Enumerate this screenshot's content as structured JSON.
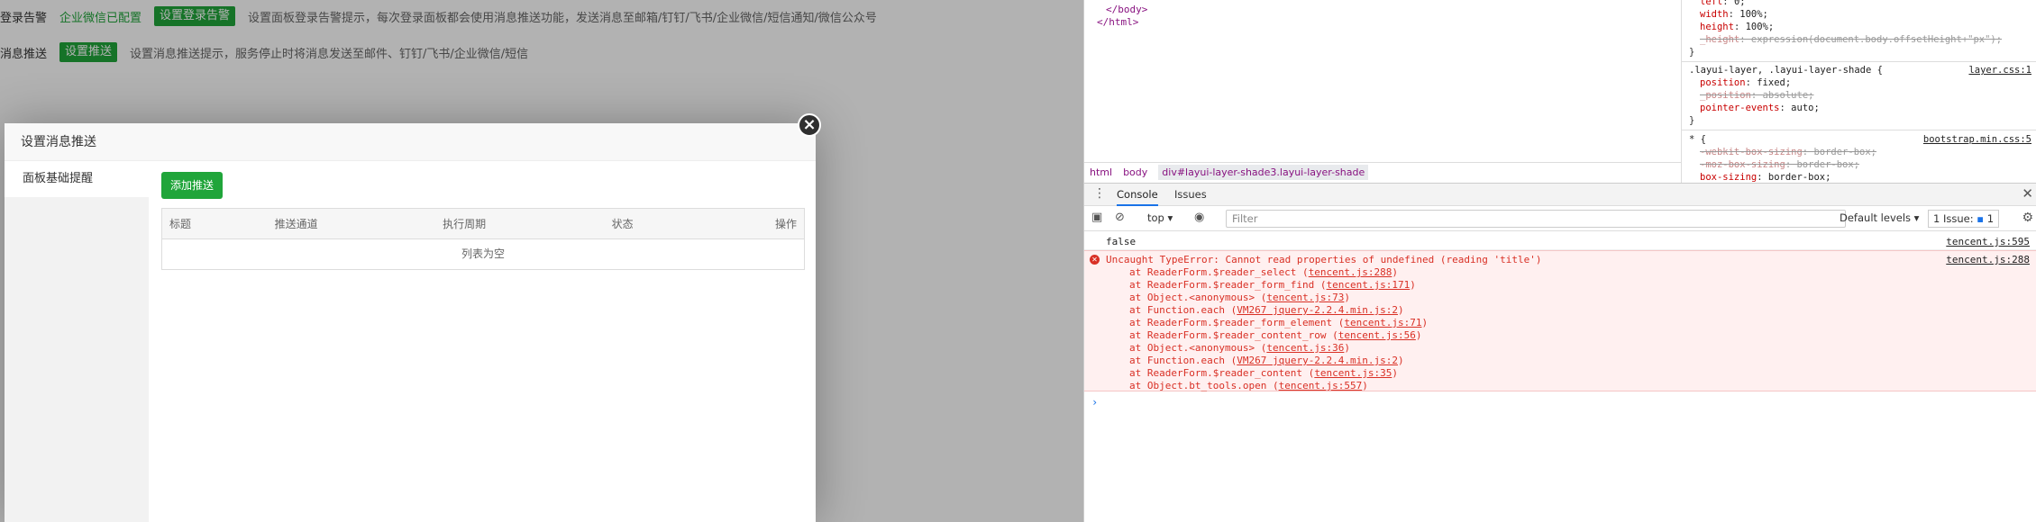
{
  "page": {
    "row1": {
      "label": "登录告警",
      "status": "企业微信已配置",
      "button": "设置登录告警",
      "hint": "设置面板登录告警提示，每次登录面板都会使用消息推送功能，发送消息至邮箱/钉钉/飞书/企业微信/短信通知/微信公众号"
    },
    "row2": {
      "label": "消息推送",
      "button": "设置推送",
      "hint": "设置消息推送提示，服务停止时将消息发送至邮件、钉钉/飞书/企业微信/短信"
    }
  },
  "dialog": {
    "title": "设置消息推送",
    "close_symbol": "×",
    "side_items": [
      "面板基础提醒"
    ],
    "add_button": "添加推送",
    "table": {
      "columns": [
        "标题",
        "推送通道",
        "执行周期",
        "状态",
        "操作"
      ],
      "empty_text": "列表为空"
    }
  },
  "devtools": {
    "elements": {
      "lines": [
        "</body>",
        "</html>"
      ]
    },
    "breadcrumb": [
      "html",
      "body",
      "div#layui-layer-shade3.layui-layer-shade"
    ],
    "styles": {
      "block1": [
        {
          "prop": "left",
          "val": "0;"
        },
        {
          "prop": "width",
          "val": "100%;"
        },
        {
          "prop": "height",
          "val": "100%;"
        },
        {
          "prop": "_height",
          "val": "expression(document.body.offsetHeight+\"px\");"
        }
      ],
      "block2_selector": ".layui-layer, .layui-layer-shade {",
      "block2_src": "layer.css:1",
      "block2": [
        {
          "prop": "position",
          "val": "fixed;"
        },
        {
          "prop": "_position",
          "val": "absolute;"
        },
        {
          "prop": "pointer-events",
          "val": "auto;"
        }
      ],
      "block3_selector": "* {",
      "block3_src": "bootstrap.min.css:5",
      "block3": [
        {
          "prop": "-webkit-box-sizing",
          "val": "border-box;"
        },
        {
          "prop": "-moz-box-sizing",
          "val": "border-box;"
        },
        {
          "prop": "box-sizing",
          "val": "border-box;"
        }
      ],
      "close_brace": "}"
    },
    "tabs": {
      "console": "Console",
      "issues": "Issues"
    },
    "toolbar": {
      "context": "top",
      "filter_placeholder": "Filter",
      "levels": "Default levels",
      "issues_label": "1 Issue:",
      "issues_count": "1"
    },
    "logs": [
      {
        "text": "false",
        "src": "tencent.js:595"
      }
    ],
    "error": {
      "message": "Uncaught TypeError: Cannot read properties of undefined (reading 'title')",
      "src": "tencent.js:288",
      "stack": [
        {
          "fn": "at ReaderForm.$reader_select",
          "loc": "tencent.js:288"
        },
        {
          "fn": "at ReaderForm.$reader_form_find",
          "loc": "tencent.js:171"
        },
        {
          "fn": "at Object.<anonymous>",
          "loc": "tencent.js:73"
        },
        {
          "fn": "at Function.each",
          "loc": "VM267 jquery-2.2.4.min.js:2"
        },
        {
          "fn": "at ReaderForm.$reader_form_element",
          "loc": "tencent.js:71"
        },
        {
          "fn": "at ReaderForm.$reader_content_row",
          "loc": "tencent.js:56"
        },
        {
          "fn": "at Object.<anonymous>",
          "loc": "tencent.js:36"
        },
        {
          "fn": "at Function.each",
          "loc": "VM267 jquery-2.2.4.min.js:2"
        },
        {
          "fn": "at ReaderForm.$reader_content",
          "loc": "tencent.js:35"
        },
        {
          "fn": "at Object.bt_tools.open",
          "loc": "tencent.js:557"
        }
      ]
    },
    "prompt_symbol": "›"
  },
  "colors": {
    "brand_green": "#20a53a",
    "error_red": "#d93025",
    "devtools_blue": "#1a73e8"
  }
}
